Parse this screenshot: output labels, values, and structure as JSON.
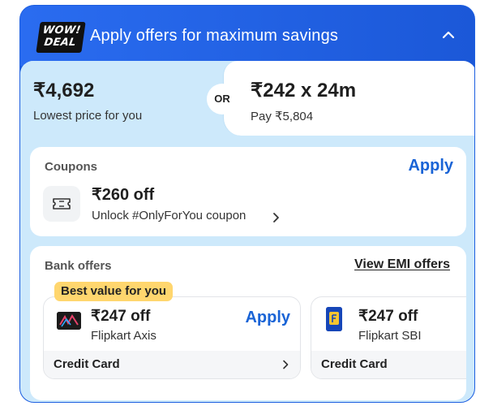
{
  "header": {
    "badge_line1": "WOW!",
    "badge_line2": "DEAL",
    "title": "Apply offers for maximum savings"
  },
  "price": {
    "lowest_value": "₹4,692",
    "lowest_label": "Lowest price for you",
    "or_label": "OR",
    "emi_value": "₹242 x 24m",
    "emi_label": "Pay ₹5,804"
  },
  "coupons": {
    "title": "Coupons",
    "apply_label": "Apply",
    "amount": "₹260 off",
    "description": "Unlock #OnlyForYou coupon"
  },
  "bank_offers": {
    "title": "Bank offers",
    "view_emi_label": "View EMI offers",
    "best_value_tag": "Best value for you",
    "offers": [
      {
        "amount": "₹247 off",
        "bank": "Flipkart Axis",
        "apply_label": "Apply",
        "card_type": "Credit Card"
      },
      {
        "amount": "₹247 off",
        "bank": "Flipkart SBI",
        "card_type": "Credit Card"
      }
    ]
  },
  "colors": {
    "header_blue": "#1d5fe0",
    "body_light_blue": "#cde9fb",
    "apply_blue": "#1a64d6",
    "best_value_yellow": "#ffd66e"
  }
}
